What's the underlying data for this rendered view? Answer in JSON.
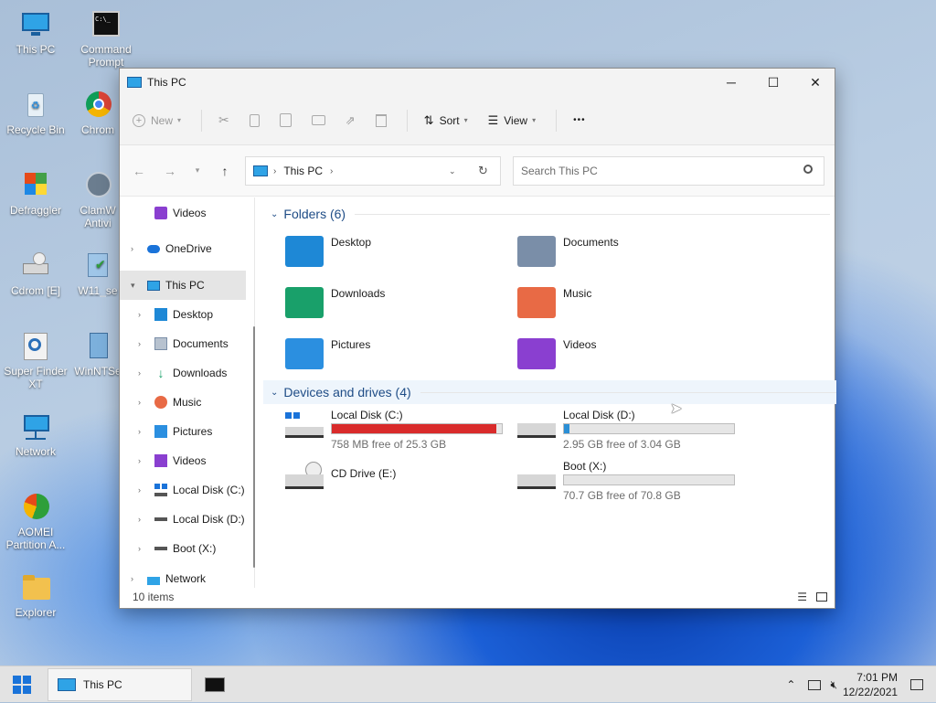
{
  "desktop": {
    "icons": [
      {
        "label": "This PC"
      },
      {
        "label": "Command Prompt"
      },
      {
        "label": "Recycle Bin"
      },
      {
        "label": "Chrom"
      },
      {
        "label": "Defraggler"
      },
      {
        "label": "ClamW Antivi"
      },
      {
        "label": "Cdrom [E]"
      },
      {
        "label": "W11_se"
      },
      {
        "label": "Super Finder XT"
      },
      {
        "label": "WinNTSe"
      },
      {
        "label": "Network"
      },
      {
        "label": "AOMEI Partition A..."
      },
      {
        "label": "Explorer"
      }
    ]
  },
  "window": {
    "title": "This PC",
    "controls": {
      "minimize": "─",
      "maximize": "☐",
      "close": "✕"
    },
    "toolbar": {
      "new_label": "New",
      "sort_label": "Sort",
      "view_label": "View",
      "more_label": "•••"
    },
    "address": {
      "crumb": "This PC",
      "search_placeholder": "Search This PC"
    },
    "sidebar": {
      "items": [
        {
          "label": "Videos"
        },
        {
          "label": "OneDrive"
        },
        {
          "label": "This PC"
        },
        {
          "label": "Desktop"
        },
        {
          "label": "Documents"
        },
        {
          "label": "Downloads"
        },
        {
          "label": "Music"
        },
        {
          "label": "Pictures"
        },
        {
          "label": "Videos"
        },
        {
          "label": "Local Disk (C:)"
        },
        {
          "label": "Local Disk (D:)"
        },
        {
          "label": "Boot (X:)"
        },
        {
          "label": "Network"
        }
      ]
    },
    "folders_header": "Folders (6)",
    "folders": [
      {
        "label": "Desktop",
        "color": "#1e88d6"
      },
      {
        "label": "Documents",
        "color": "#7a8ea8"
      },
      {
        "label": "Downloads",
        "color": "#19a06a"
      },
      {
        "label": "Music",
        "color": "#e86a45"
      },
      {
        "label": "Pictures",
        "color": "#2b8fe0"
      },
      {
        "label": "Videos",
        "color": "#8a3fd0"
      }
    ],
    "drives_header": "Devices and drives (4)",
    "drives": [
      {
        "name": "Local Disk (C:)",
        "free": "758 MB free of 25.3 GB",
        "used_fraction": 0.97,
        "bar_color": "#d92b2b",
        "has_bar": true
      },
      {
        "name": "Local Disk (D:)",
        "free": "2.95 GB free of 3.04 GB",
        "used_fraction": 0.03,
        "bar_color": "#2a8fd6",
        "has_bar": true
      },
      {
        "name": "CD Drive (E:)",
        "free": "",
        "used_fraction": 0,
        "bar_color": "#2a8fd6",
        "has_bar": false
      },
      {
        "name": "Boot (X:)",
        "free": "70.7 GB free of 70.8 GB",
        "used_fraction": 0.0,
        "bar_color": "#2a8fd6",
        "has_bar": true
      }
    ],
    "status": {
      "items": "10 items"
    }
  },
  "taskbar": {
    "app_label": "This PC",
    "time": "7:01 PM",
    "date": "12/22/2021"
  }
}
